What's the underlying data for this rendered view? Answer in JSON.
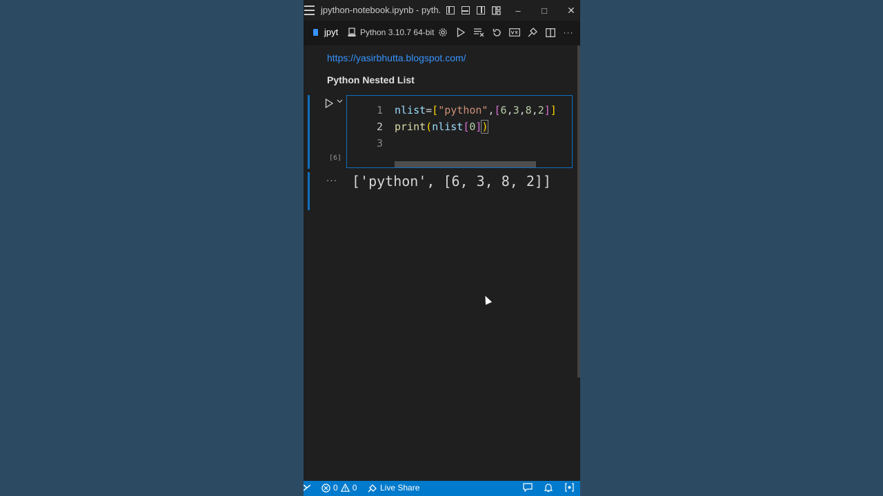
{
  "window": {
    "title": "jpython-notebook.ipynb - pyth...",
    "controls": {
      "minimize": "–",
      "maximize": "□",
      "close": "✕"
    }
  },
  "toolbar": {
    "file_tab": "jpyt",
    "kernel": "Python 3.10.7 64-bit",
    "more": "···"
  },
  "notebook": {
    "link": "https://yasirbhutta.blogspot.com/",
    "heading": "Python Nested List",
    "cell": {
      "execution_count": "[6]",
      "lines": [
        {
          "number": "1",
          "code": "nlist=[\"python\",[6,3,8,2]]"
        },
        {
          "number": "2",
          "code": "print(nlist[0])"
        },
        {
          "number": "3",
          "code": ""
        }
      ]
    },
    "output": {
      "ellipsis": "···",
      "text": "['python', [6, 3, 8, 2]]"
    }
  },
  "statusbar": {
    "errors": "0",
    "warnings": "0",
    "live_share": "Live Share"
  },
  "colors": {
    "accent": "#007acc",
    "link": "#3794ff",
    "string": "#ce9178",
    "bracket1": "#ffd700",
    "bracket2": "#da70d6",
    "number": "#b5cea8",
    "function": "#dcdcaa",
    "variable": "#9cdcfe"
  }
}
